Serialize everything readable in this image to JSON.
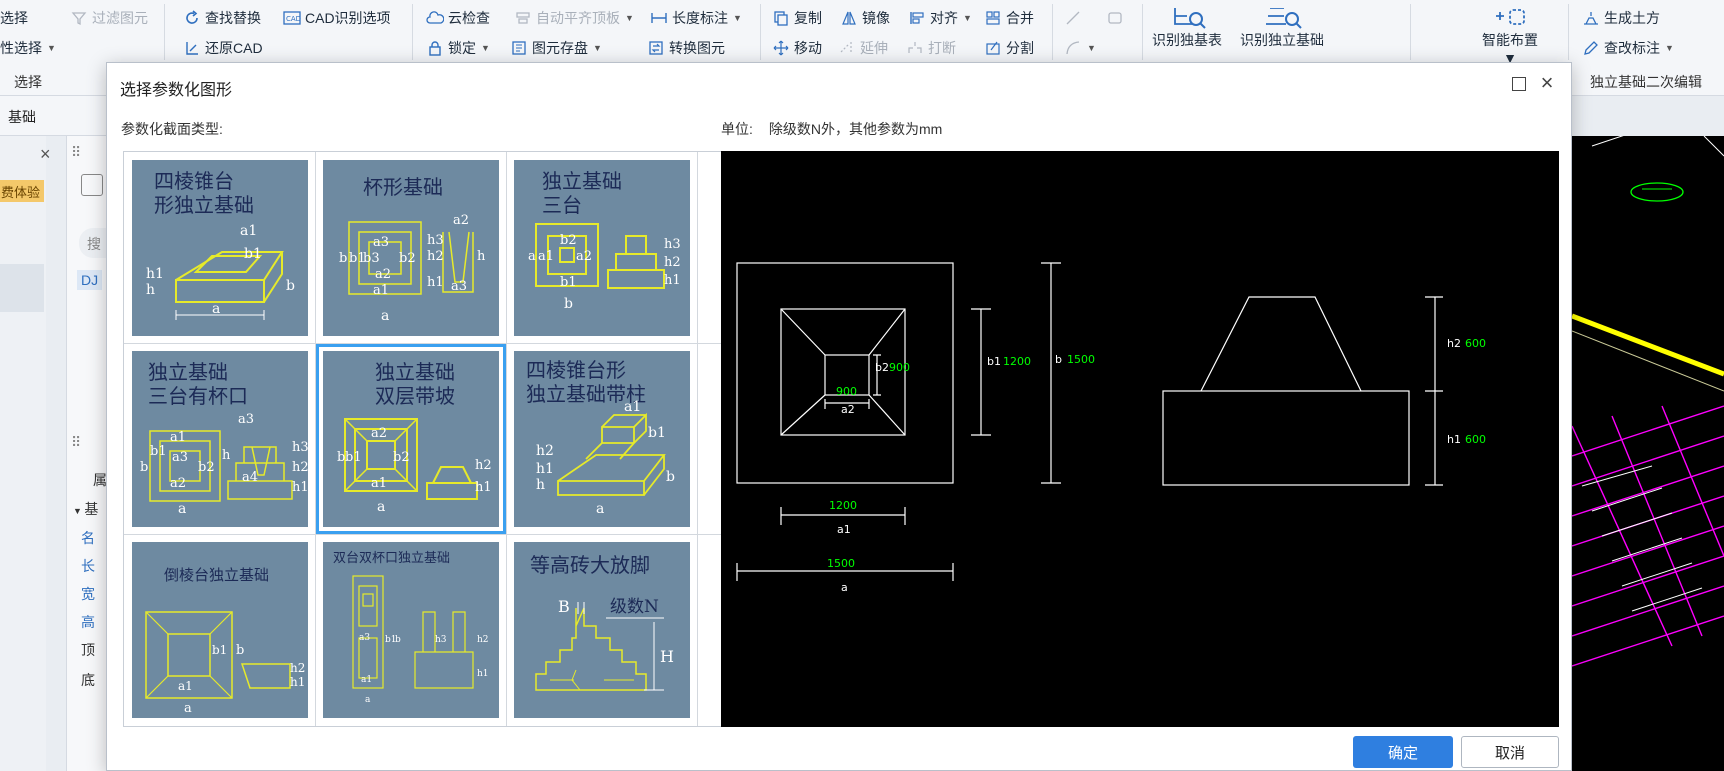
{
  "ribbon": {
    "select_item": "选择",
    "filter": "过滤图元",
    "attr_select": "性选择",
    "find_replace": "查找替换",
    "cad_options": "CAD识别选项",
    "restore_cad": "还原CAD",
    "cloud_check": "云检查",
    "auto_align": "自动平齐顶板",
    "length_mark": "长度标注",
    "lock": "锁定",
    "save_element": "图元存盘",
    "convert_element": "转换图元",
    "copy": "复制",
    "mirror": "镜像",
    "align": "对齐",
    "merge": "合并",
    "move": "移动",
    "extend": "延伸",
    "break": "打断",
    "split": "分割",
    "identify_table": "识别独基表",
    "identify_foundation": "识别独立基础",
    "smart_layout": "智能布置",
    "gen_earthwork": "生成土方",
    "edit_mark": "查改标注",
    "group_select": "选择",
    "secondary_edit": "独立基础二次编辑"
  },
  "app": {
    "tab": "基础",
    "badge": "费体验",
    "dj": "DJ",
    "search": "搜",
    "name_frag": "名",
    "length_frag": "长",
    "width_frag": "宽",
    "height_frag": "高",
    "top_frag": "顶",
    "bottom_frag": "底",
    "base_frag": "基",
    "col_frag": "属"
  },
  "dialog": {
    "title": "选择参数化图形",
    "type_label": "参数化截面类型:",
    "unit_label": "单位:",
    "unit_text": "除级数N外，其他参数为mm",
    "ok": "确定",
    "cancel": "取消"
  },
  "shapes": [
    {
      "title1": "四棱锥台",
      "title2": "形独立基础"
    },
    {
      "title1": "杯形基础",
      "title2": ""
    },
    {
      "title1": "独立基础",
      "title2": "三台"
    },
    {
      "title1": "独立基础",
      "title2": "三台有杯口"
    },
    {
      "title1": "独立基础",
      "title2": "双层带坡"
    },
    {
      "title1": "四棱锥台形",
      "title2": "独立基础带柱"
    },
    {
      "title1": "倒棱台独立基础",
      "title2": ""
    },
    {
      "title1": "双台双杯口独立基础",
      "title2": ""
    },
    {
      "title1": "等高砖大放脚",
      "title2": ""
    }
  ],
  "shape_labels": {
    "a": "a",
    "a1": "a1",
    "a2": "a2",
    "a3": "a3",
    "a4": "a4",
    "b": "b",
    "b1": "b1",
    "b2": "b2",
    "b3": "b3",
    "h": "h",
    "h1": "h1",
    "h2": "h2",
    "h3": "h3",
    "B": "B",
    "H": "H",
    "N": "级数N"
  },
  "preview": {
    "a_label": "a",
    "a_value": "1500",
    "a1_label": "a1",
    "a1_value": "1200",
    "a2_label": "a2",
    "a2_value": "900",
    "b_label": "b",
    "b_value": "1500",
    "b1_label": "b1",
    "b1_value": "1200",
    "b2_label": "b2",
    "b2_value": "900",
    "h1_label": "h1",
    "h1_value": "600",
    "h2_label": "h2",
    "h2_value": "600"
  },
  "colors": {
    "accent": "#2f7fe0",
    "selection": "#3aa0f0",
    "thumb_bg": "#6e8aa1",
    "cad_green": "#00ff00",
    "cad_yellow": "#ffff00",
    "cad_magenta": "#ff00ff"
  }
}
